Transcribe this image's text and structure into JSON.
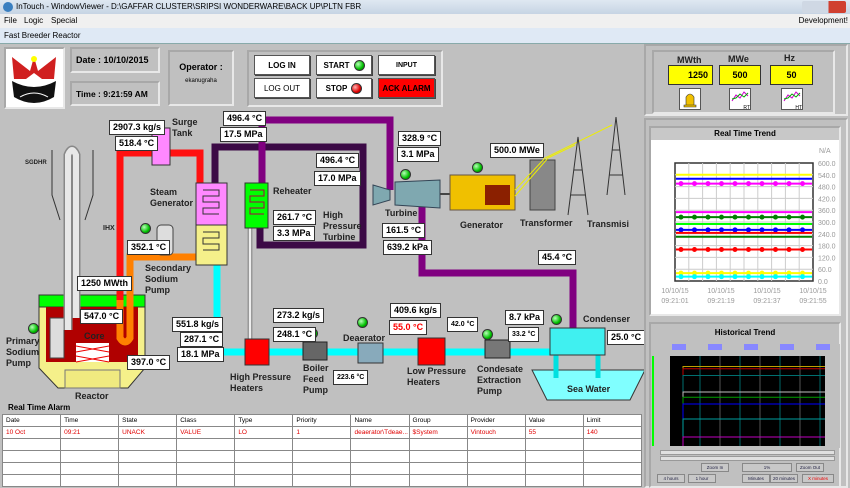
{
  "window": {
    "title": "InTouch - WindowViewer - D:\\GAFFAR CLUSTER\\SRIPSI WONDERWARE\\BACK UP\\PLTN FBR",
    "menu": [
      "File",
      "Logic",
      "Special"
    ],
    "mode": "Development!",
    "caption": "Fast Breeder Reactor"
  },
  "header": {
    "date": "Date : 10/10/2015",
    "time": "Time :  9:21:59 AM",
    "operator_label": "Operator :",
    "operator_name": "ekanugraha",
    "buttons": {
      "login": "LOG IN",
      "logout": "LOG OUT",
      "start": "START",
      "stop": "STOP",
      "input": "INPUT",
      "ack": "ACK ALARM"
    }
  },
  "summary": {
    "mwth_label": "MWth",
    "mwe_label": "MWe",
    "hz_label": "Hz",
    "mwth": "1250",
    "mwe": "500",
    "hz": "50",
    "icons": [
      "alarm-bell-icon",
      "realtime-trend-icon",
      "historical-trend-icon"
    ],
    "icon_text": [
      "RT",
      "HT"
    ]
  },
  "diagram": {
    "labels": {
      "sgdhr": "SGDHR",
      "surge_tank": "Surge Tank",
      "steam_generator": "Steam Generator",
      "reheater": "Reheater",
      "ihx": "IHX",
      "secondary_pump": "Secondary Sodium Pump",
      "primary_pump": "Primary Sodium Pump",
      "core": "Core",
      "reactor": "Reactor",
      "hp_heaters": "High Pressure Heaters",
      "boiler_pump": "Boiler Feed Pump",
      "hp_turbine": "High Pressure Turbine",
      "turbine": "Turbine",
      "generator": "Generator",
      "transformer": "Transformer",
      "transmisi": "Transmisi",
      "deaerator": "Deaerator",
      "lp_heaters": "Low Pressure Heaters",
      "condensate_pump": "Condesate Extraction Pump",
      "condenser": "Condenser",
      "sea_water": "Sea Water"
    },
    "values": {
      "surge_flow": "2907.3 kg/s",
      "surge_temp": "518.4 °C",
      "sg_out_temp": "496.4 °C",
      "sg_out_press": "17.5 MPa",
      "hpt_in_temp": "496.4 °C",
      "hpt_in_press": "17.0 MPa",
      "reheat_temp": "261.7 °C",
      "reheat_press": "3.3 MPa",
      "sec_pump_temp": "352.1 °C",
      "reactor_power": "1250 MWth",
      "core_temp": "547.0 °C",
      "reactor_out_temp": "397.0 °C",
      "fw_flow": "551.8 kg/s",
      "fw_temp": "287.1 °C",
      "fw_press": "18.1 MPa",
      "bfp_flow": "273.2 kg/s",
      "bfp_temp": "248.1 °C",
      "turb_in_temp": "328.9 °C",
      "turb_in_press": "3.1 MPa",
      "turb_out_temp": "161.5 °C",
      "turb_out_press": "639.2 kPa",
      "gen_power": "500.0 MWe",
      "cond_in_temp": "45.4 °C",
      "lp_flow": "409.6 kg/s",
      "lp_temp": "55.0 °C",
      "lp_out_temp": "42.0 °C",
      "deaerator_temp": "223.6 °C",
      "cond_press": "8.7 kPa",
      "cond_temp": "33.2 °C",
      "sea_temp": "25.0 °C"
    },
    "colors": {
      "sodium_primary": "#ff1010",
      "sodium_secondary": "#ff8000",
      "steam": "#800080",
      "reheat": "#3c0a46",
      "water": "#00ffff"
    }
  },
  "alarm": {
    "title": "Real Time Alarm",
    "columns": [
      "Date",
      "Time",
      "State",
      "Class",
      "Type",
      "Priority",
      "Name",
      "Group",
      "Provider",
      "Value",
      "Limit"
    ],
    "rows": [
      [
        "10 Oct",
        "09:21",
        "UNACK",
        "VALUE",
        "LO",
        "1",
        "deaerator\\Tdeae...",
        "$System",
        "Vintouch",
        "55",
        "140"
      ]
    ]
  },
  "realtime_trend": {
    "title": "Real Time Trend",
    "unit": "N/A",
    "yticks": [
      "600.0",
      "540.0",
      "480.0",
      "420.0",
      "360.0",
      "300.0",
      "240.0",
      "180.0",
      "120.0",
      "60.0",
      "0.0"
    ],
    "xticks": [
      [
        "10/10/15",
        "09:21:01"
      ],
      [
        "10/10/15",
        "09:21:19"
      ],
      [
        "10/10/15",
        "09:21:37"
      ],
      [
        "10/10/15",
        "09:21:55"
      ]
    ],
    "chart_data": {
      "type": "line",
      "ylim": [
        0,
        600
      ],
      "grid": true,
      "series": [
        {
          "color": "#ffff00",
          "value": 540,
          "markers": false
        },
        {
          "color": "#0000ff",
          "value": 520,
          "markers": false
        },
        {
          "color": "#ff00ff",
          "value": 495,
          "markers": true
        },
        {
          "color": "#ff00ff",
          "value": 350,
          "markers": false
        },
        {
          "color": "#008000",
          "value": 325,
          "markers": true
        },
        {
          "color": "#00ff00",
          "value": 290,
          "markers": false
        },
        {
          "color": "#0000ff",
          "value": 260,
          "markers": true
        },
        {
          "color": "#ff0000",
          "value": 245,
          "markers": false
        },
        {
          "color": "#008000",
          "value": 225,
          "markers": false
        },
        {
          "color": "#ff0000",
          "value": 160,
          "markers": true
        },
        {
          "color": "#ffff00",
          "value": 40,
          "markers": true
        },
        {
          "color": "#00ffff",
          "value": 22,
          "markers": true
        }
      ]
    }
  },
  "historical_trend": {
    "title": "Historical Trend",
    "chart_data": {
      "type": "line",
      "ylim": [
        0,
        600
      ],
      "series": [
        {
          "color": "#c0a000",
          "value": 530
        },
        {
          "color": "#c00000",
          "value": 515
        },
        {
          "color": "#007070",
          "value": 470
        },
        {
          "color": "#c0c0c0",
          "value": 360
        },
        {
          "color": "#00a000",
          "value": 325
        },
        {
          "color": "#0000ff",
          "value": 280
        },
        {
          "color": "#00a0a0",
          "value": 180
        },
        {
          "color": "#c000c0",
          "value": 60
        }
      ]
    },
    "buttons": [
      "Zoom In",
      "1%",
      "Zoom Out",
      "4 hours",
      "1 hour",
      "Minutes",
      "20 minutes",
      "X minutes"
    ]
  }
}
